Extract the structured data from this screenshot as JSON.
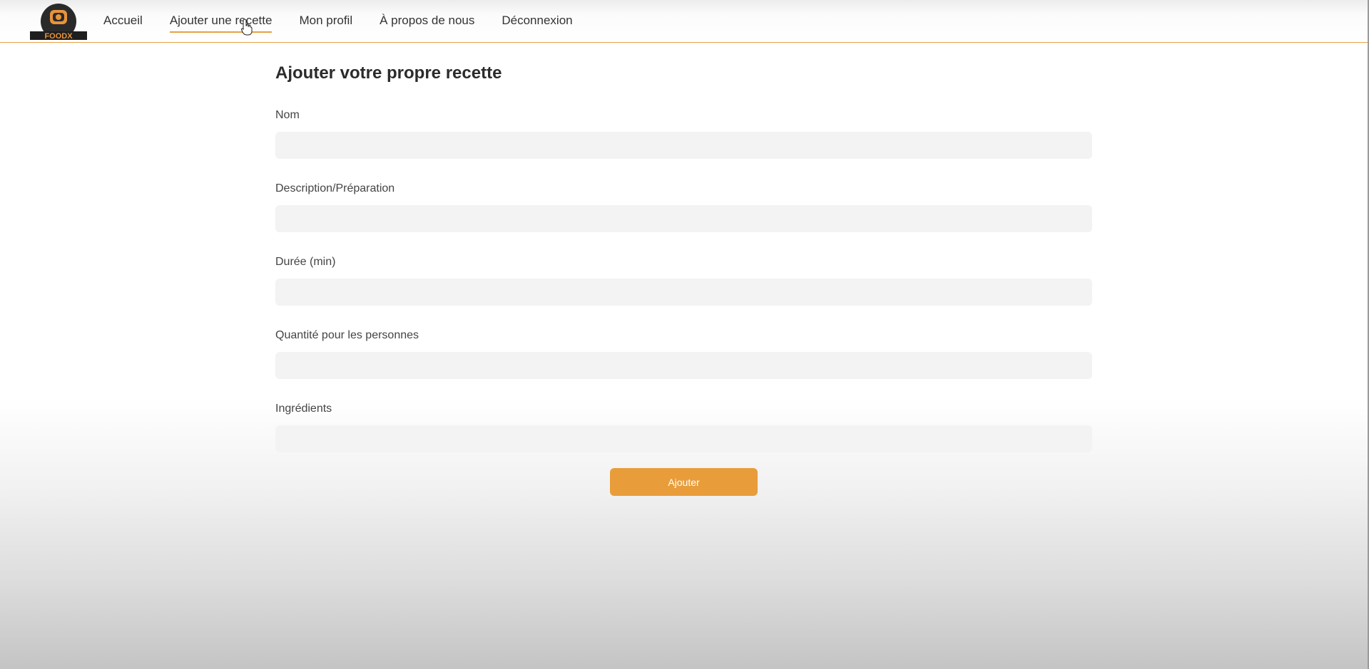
{
  "brand": {
    "logo_text": "FOODX",
    "accent_color": "#e8a040"
  },
  "nav": {
    "items": [
      {
        "label": "Accueil"
      },
      {
        "label": "Ajouter une recette"
      },
      {
        "label": "Mon profil"
      },
      {
        "label": "À propos de nous"
      },
      {
        "label": "Déconnexion"
      }
    ],
    "active_index": 1
  },
  "form": {
    "title": "Ajouter votre propre recette",
    "fields": [
      {
        "label": "Nom",
        "value": "",
        "placeholder": ""
      },
      {
        "label": "Description/Préparation",
        "value": "",
        "placeholder": ""
      },
      {
        "label": "Durée (min)",
        "value": "",
        "placeholder": ""
      },
      {
        "label": "Quantité pour les personnes",
        "value": "",
        "placeholder": ""
      },
      {
        "label": "Ingrédients",
        "value": "",
        "placeholder": ""
      }
    ],
    "submit_label": "Ajouter",
    "submit_color": "#e89d3a"
  },
  "cursor": {
    "icon": "hand-pointer-icon"
  }
}
